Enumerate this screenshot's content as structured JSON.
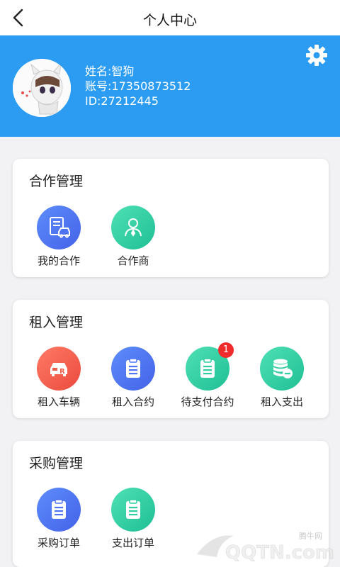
{
  "nav": {
    "title": "个人中心"
  },
  "profile": {
    "name_line": "姓名:智狗",
    "account_line": "账号:17350873512",
    "id_line": "ID:27212445"
  },
  "sections": [
    {
      "title": "合作管理",
      "items": [
        {
          "label": "我的合作",
          "icon": "contract-car-icon",
          "color": "blue"
        },
        {
          "label": "合作商",
          "icon": "partner-person-icon",
          "color": "green"
        }
      ]
    },
    {
      "title": "租入管理",
      "items": [
        {
          "label": "租入车辆",
          "icon": "car-icon",
          "color": "red"
        },
        {
          "label": "租入合约",
          "icon": "clipboard-icon",
          "color": "blue"
        },
        {
          "label": "待支付合约",
          "icon": "clipboard-icon",
          "color": "green",
          "badge": "1"
        },
        {
          "label": "租入支出",
          "icon": "coins-minus-icon",
          "color": "green"
        }
      ]
    },
    {
      "title": "采购管理",
      "items": [
        {
          "label": "采购订单",
          "icon": "clipboard-icon",
          "color": "blue"
        },
        {
          "label": "支出订单",
          "icon": "clipboard-icon",
          "color": "green"
        }
      ]
    }
  ],
  "watermark": {
    "brand": "QQTN.com",
    "site": "腾牛网"
  },
  "colors": {
    "header": "#2b9cf2",
    "blue_icon": "#4f74f3",
    "green_icon": "#2fcfa2",
    "red_icon": "#f05c4c",
    "badge": "#f02b2b"
  }
}
